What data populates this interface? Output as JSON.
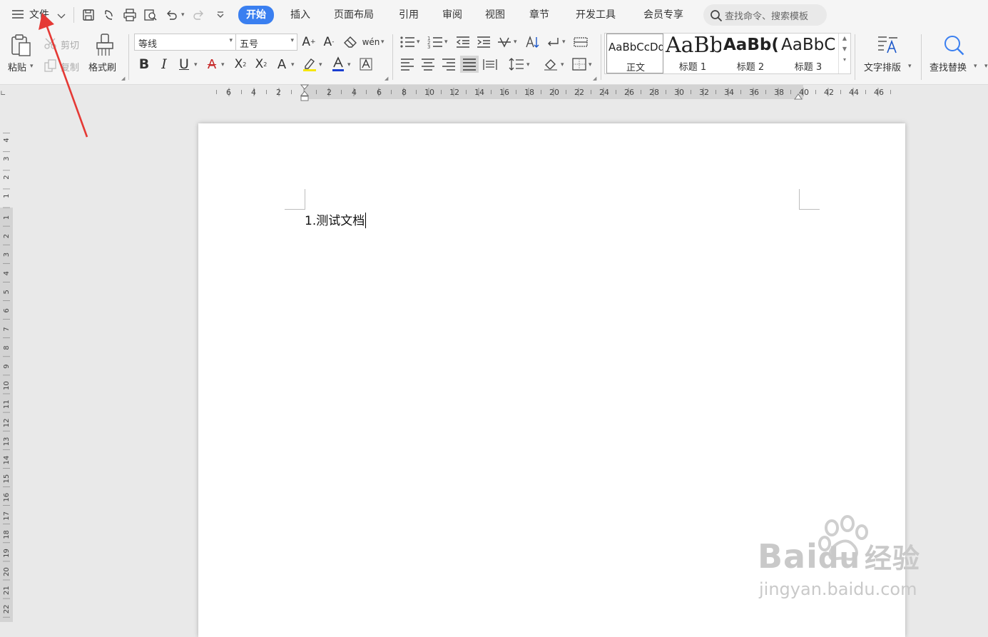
{
  "menu": {
    "file_label": "文件",
    "tabs": [
      {
        "label": "开始",
        "active": true
      },
      {
        "label": "插入"
      },
      {
        "label": "页面布局"
      },
      {
        "label": "引用"
      },
      {
        "label": "审阅"
      },
      {
        "label": "视图"
      },
      {
        "label": "章节"
      },
      {
        "label": "开发工具"
      },
      {
        "label": "会员专享"
      }
    ],
    "search_placeholder": "查找命令、搜索模板",
    "accent_color": "#3a7ff0"
  },
  "ribbon": {
    "paste_label": "粘贴",
    "cut_label": "剪切",
    "copy_label": "复制",
    "format_painter_label": "格式刷",
    "font_name": "等线",
    "font_size": "五号",
    "styles": [
      {
        "preview": "AaBbCcDd",
        "caption": "正文"
      },
      {
        "preview": "AaBb",
        "caption": "标题 1"
      },
      {
        "preview": "AaBb(",
        "caption": "标题 2"
      },
      {
        "preview": "AaBbC",
        "caption": "标题 3"
      }
    ],
    "text_layout_label": "文字排版",
    "find_replace_label": "查找替换"
  },
  "ruler": {
    "h_left_numbers": [
      "6",
      "4",
      "2"
    ],
    "h_right_numbers": [
      "2",
      "4",
      "6",
      "8",
      "10",
      "12",
      "14",
      "16",
      "18",
      "20",
      "22",
      "24",
      "26",
      "28",
      "30",
      "32",
      "34",
      "36",
      "38",
      "40",
      "42",
      "44",
      "46"
    ],
    "v_top_numbers": [
      "4",
      "3",
      "2",
      "1"
    ],
    "v_bottom_numbers": [
      "1",
      "2",
      "3",
      "4",
      "5",
      "6",
      "7",
      "8",
      "9",
      "10",
      "11",
      "12",
      "13",
      "14",
      "15",
      "16",
      "17",
      "18",
      "19",
      "20",
      "21",
      "22"
    ]
  },
  "document": {
    "text": "1.测试文档"
  },
  "watermark": {
    "line1": "Bai",
    "line1_b": "du",
    "line1_c": "经验",
    "line2": "jingyan.baidu.com"
  },
  "annotation_color": "#e53935"
}
